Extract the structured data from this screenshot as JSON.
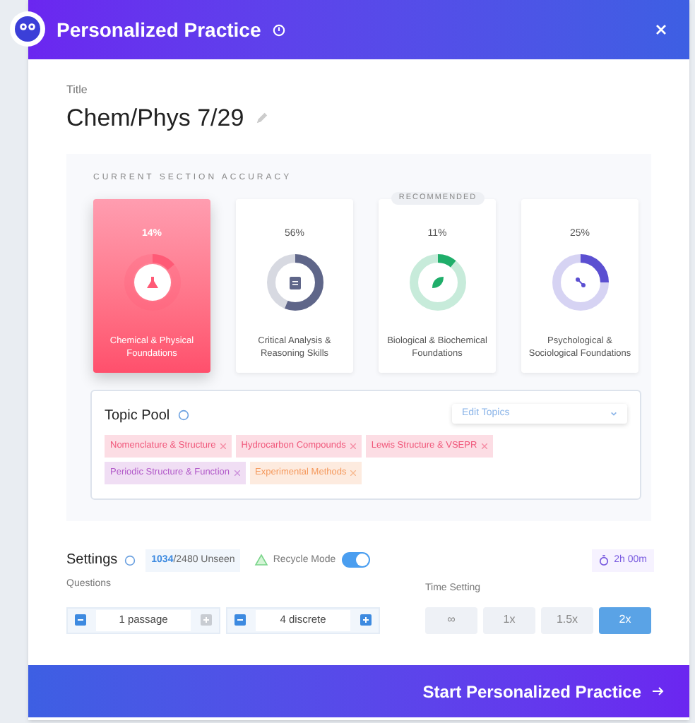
{
  "header": {
    "title": "Personalized Practice"
  },
  "title_field": {
    "label": "Title",
    "value": "Chem/Phys 7/29"
  },
  "accuracy": {
    "heading": "CURRENT SECTION ACCURACY",
    "sections": [
      {
        "percent": "14%",
        "level": 0.14,
        "name": "Chemical & Physical Foundations",
        "selected": true,
        "color": "#ff5a76",
        "kind": "flask"
      },
      {
        "percent": "56%",
        "level": 0.56,
        "name": "Critical Analysis & Reasoning Skills",
        "selected": false,
        "color": "#5f6689",
        "kind": "clipboard"
      },
      {
        "percent": "11%",
        "level": 0.11,
        "name": "Biological & Biochemical Foundations",
        "selected": false,
        "color": "#1fae6a",
        "kind": "leaf",
        "badge": "RECOMMENDED"
      },
      {
        "percent": "25%",
        "level": 0.25,
        "name": "Psychological & Sociological Foundations",
        "selected": false,
        "color": "#5b4fd1",
        "kind": "molecule"
      }
    ]
  },
  "topic_pool": {
    "title": "Topic Pool",
    "dropdown": "Edit Topics",
    "tags": [
      {
        "label": "Nomenclature & Structure",
        "color": "#f0577a"
      },
      {
        "label": "Hydrocarbon Compounds",
        "color": "#f0577a"
      },
      {
        "label": "Lewis Structure & VSEPR",
        "color": "#f0577a"
      },
      {
        "label": "Periodic Structure & Function",
        "color": "#b25ac9"
      },
      {
        "label": "Experimental Methods",
        "color": "#f59a5e"
      }
    ]
  },
  "settings": {
    "title": "Settings",
    "unseen_count": "1034",
    "unseen_rest": "/2480 Unseen",
    "recycle_label": "Recycle Mode",
    "recycle_on": true,
    "time_total": "2h 00m",
    "questions_label": "Questions",
    "steppers": [
      {
        "value": "1 passage",
        "minus_enabled": true,
        "plus_enabled": false
      },
      {
        "value": "4 discrete",
        "minus_enabled": true,
        "plus_enabled": true
      }
    ],
    "time_label": "Time Setting",
    "time_options": [
      {
        "label": "∞",
        "selected": false
      },
      {
        "label": "1x",
        "selected": false
      },
      {
        "label": "1.5x",
        "selected": false
      },
      {
        "label": "2x",
        "selected": true
      }
    ]
  },
  "footer": {
    "button": "Start Personalized Practice"
  }
}
